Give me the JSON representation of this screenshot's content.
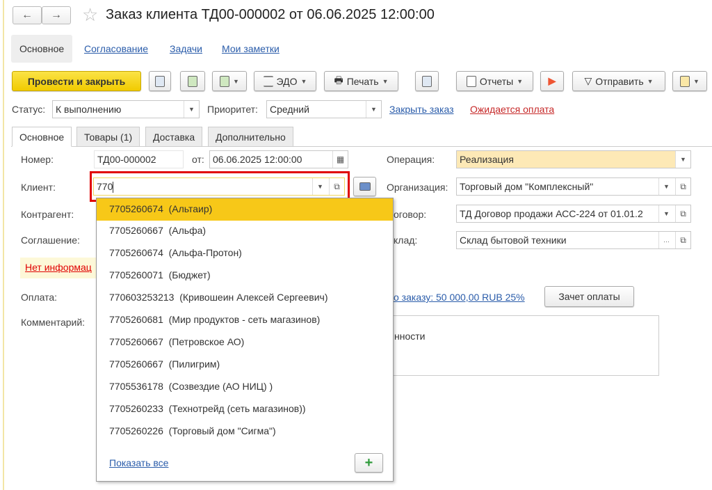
{
  "window": {
    "title": "Заказ клиента ТД00-000002 от 06.06.2025 12:00:00",
    "back_icon": "←",
    "forward_icon": "→",
    "star_icon": "☆"
  },
  "top_tabs": [
    {
      "label": "Основное"
    },
    {
      "label": "Согласование"
    },
    {
      "label": "Задачи"
    },
    {
      "label": "Мои заметки"
    }
  ],
  "toolbar": {
    "post_close": "Провести и закрыть",
    "edo": "ЭДО",
    "print": "Печать",
    "reports": "Отчеты",
    "send": "Отправить"
  },
  "status": {
    "label": "Статус:",
    "value": "К выполнению",
    "priority_label": "Приоритет:",
    "priority_value": "Средний",
    "close_order": "Закрыть заказ",
    "awaiting_payment": "Ожидается оплата"
  },
  "tabs": [
    {
      "label": "Основное"
    },
    {
      "label": "Товары (1)"
    },
    {
      "label": "Доставка"
    },
    {
      "label": "Дополнительно"
    }
  ],
  "form": {
    "number_label": "Номер:",
    "number": "ТД00-000002",
    "date_label": "от:",
    "date": "06.06.2025 12:00:00",
    "operation_label": "Операция:",
    "operation": "Реализация",
    "client_label": "Клиент:",
    "client_input": "770",
    "org_label": "Организация:",
    "org": "Торговый дом \"Комплексный\"",
    "counterparty_label": "Контрагент:",
    "contract_label": "оговор:",
    "contract": "ТД Договор продажи АСС-224 от 01.01.2",
    "agreement_label": "Соглашение:",
    "warehouse_label": "клад:",
    "warehouse": "Склад бытовой техники",
    "no_info": "Нет информац",
    "payment_label": "Оплата:",
    "payment_link": "о заказу: 50 000,00 RUB 25%",
    "offset_button": "Зачет оплаты",
    "comment_label": "Комментарий:",
    "comment_fragment": "нности"
  },
  "dropdown": {
    "items": [
      "7705260674  (Альтаир)",
      "7705260667  (Альфа)",
      "7705260674  (Альфа-Протон)",
      "7705260071  (Бюджет)",
      "770603253213  (Кривошеин Алексей Сергеевич)",
      "7705260681  (Мир продуктов - сеть магазинов)",
      "7705260667  (Петровское АО)",
      "7705260667  (Пилигрим)",
      "7705536178  (Созвездие (АО НИЦ) )",
      "7705260233  (Технотрейд (сеть магазинов))",
      "7705260226  (Торговый дом \"Сигма\")"
    ],
    "show_all": "Показать все",
    "add_icon": "+"
  },
  "colors": {
    "primary": "#f1cb00",
    "highlight": "#f7c818",
    "operation_bg": "#fde9b6",
    "error": "#e00000",
    "link": "#2a5caa"
  }
}
